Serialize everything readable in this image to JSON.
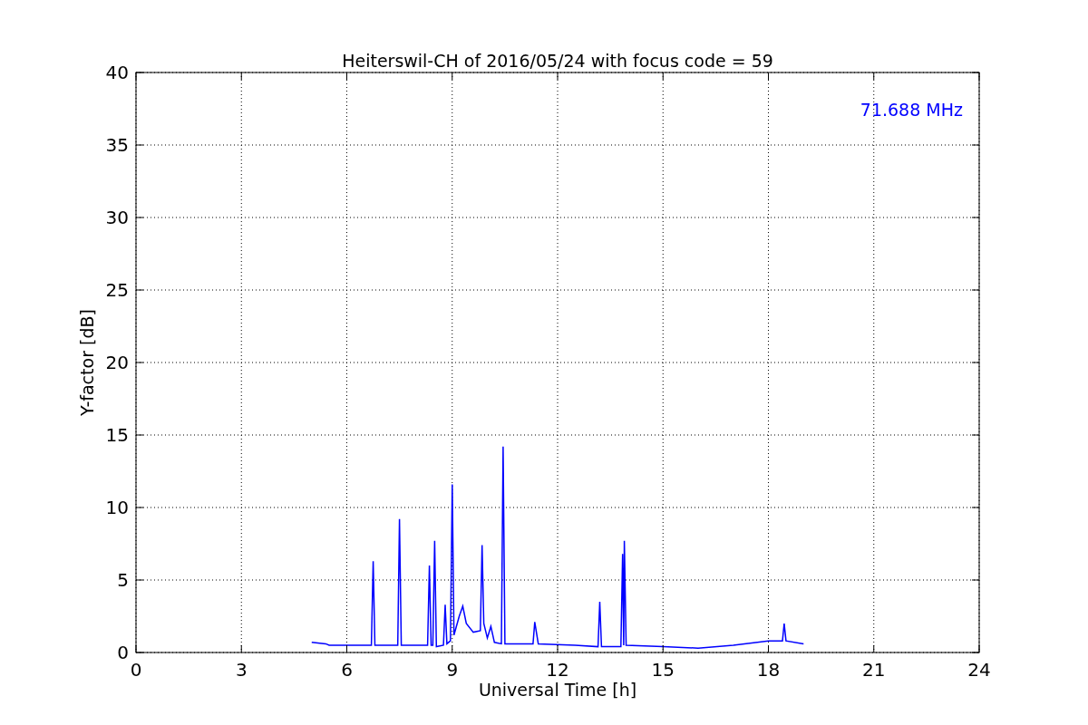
{
  "chart_data": {
    "type": "line",
    "title": "Heiterswil-CH of 2016/05/24 with focus code = 59",
    "xlabel": "Universal Time [h]",
    "ylabel": "Y-factor [dB]",
    "x": [
      5.0,
      5.4,
      5.5,
      6.0,
      6.7,
      6.75,
      6.8,
      7.45,
      7.5,
      7.55,
      8.3,
      8.35,
      8.4,
      8.45,
      8.5,
      8.55,
      8.75,
      8.8,
      8.85,
      8.95,
      9.0,
      9.05,
      9.2,
      9.3,
      9.4,
      9.6,
      9.8,
      9.85,
      9.9,
      10.0,
      10.1,
      10.2,
      10.4,
      10.45,
      10.5,
      11.3,
      11.35,
      11.45,
      12.5,
      13.15,
      13.2,
      13.25,
      13.8,
      13.85,
      13.88,
      13.9,
      13.95,
      15.0,
      16.0,
      17.0,
      18.0,
      18.4,
      18.45,
      18.5,
      19.0
    ],
    "series": [
      {
        "color": "#0000ff",
        "values": [
          0.7,
          0.6,
          0.5,
          0.5,
          0.5,
          6.3,
          0.5,
          0.5,
          9.2,
          0.5,
          0.5,
          6.0,
          0.5,
          0.5,
          7.7,
          0.4,
          0.5,
          3.3,
          0.6,
          0.8,
          11.6,
          1.2,
          2.5,
          3.2,
          2.0,
          1.4,
          1.5,
          7.4,
          2.0,
          1.0,
          1.8,
          0.7,
          0.6,
          14.2,
          0.6,
          0.6,
          2.1,
          0.6,
          0.5,
          0.4,
          3.5,
          0.4,
          0.4,
          6.8,
          0.5,
          7.7,
          0.5,
          0.4,
          0.3,
          0.5,
          0.8,
          0.8,
          2.0,
          0.8,
          0.6
        ]
      }
    ],
    "xlim": [
      0,
      24
    ],
    "ylim": [
      0,
      40
    ],
    "xticks": [
      0,
      3,
      6,
      9,
      12,
      15,
      18,
      21,
      24
    ],
    "yticks": [
      0,
      5,
      10,
      15,
      20,
      25,
      30,
      35,
      40
    ],
    "grid": true,
    "annotations": [
      {
        "text": "71.688 MHz"
      }
    ]
  }
}
